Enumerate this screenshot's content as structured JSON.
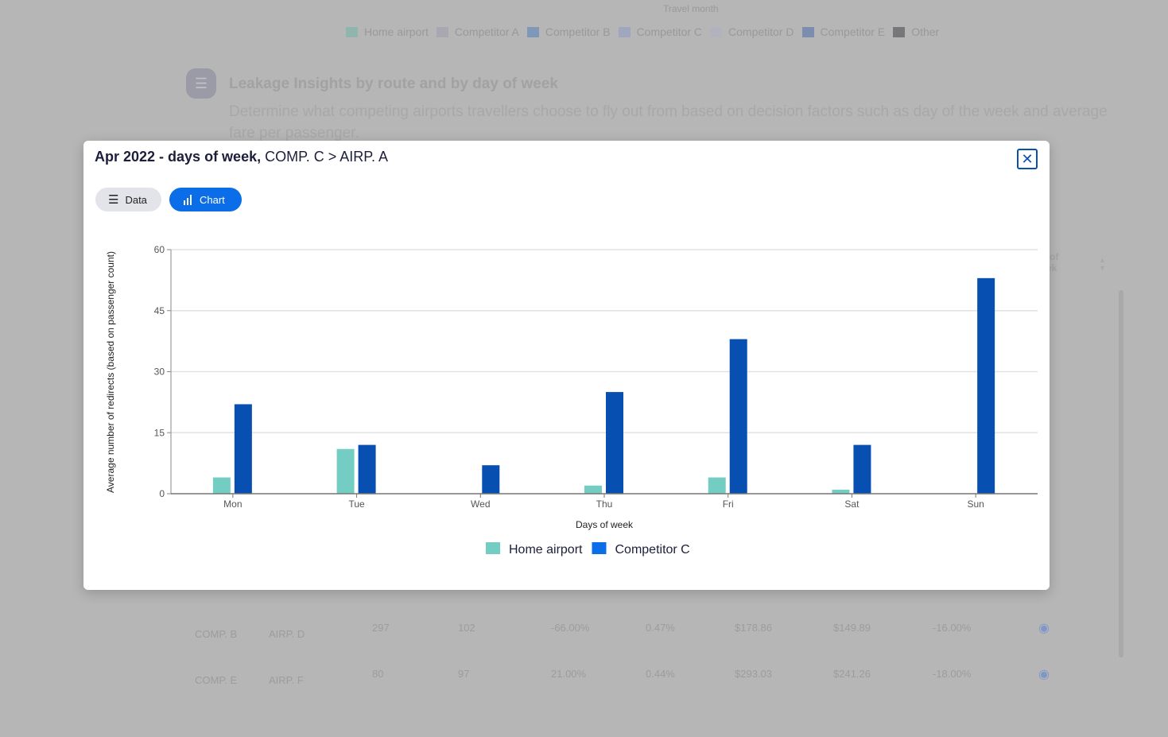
{
  "background": {
    "legend_title": "Travel month",
    "legend": [
      {
        "label": "Home airport",
        "color": "#8fb5ae"
      },
      {
        "label": "Competitor A",
        "color": "#a9a8b0"
      },
      {
        "label": "Competitor B",
        "color": "#7f97b8"
      },
      {
        "label": "Competitor C",
        "color": "#9ea7bd"
      },
      {
        "label": "Competitor D",
        "color": "#b1b2bd"
      },
      {
        "label": "Competitor E",
        "color": "#7d8db0"
      },
      {
        "label": "Other",
        "color": "#777679"
      }
    ],
    "section_title": "Leakage Insights by route and by day of week",
    "section_desc": "Determine what competing airports travellers choose to fly out from based on decision factors such as day of the week and average fare per passenger.",
    "column_header_partial": "...y of week",
    "rows": [
      [
        "COMP. B",
        "AIRP. D",
        "297",
        "102",
        "-66.00%",
        "0.47%",
        "$178.86",
        "$149.89",
        "-16.00%"
      ],
      [
        "COMP. E",
        "AIRP. F",
        "80",
        "97",
        "21.00%",
        "0.44%",
        "$293.03",
        "$241.26",
        "-18.00%"
      ]
    ]
  },
  "modal": {
    "title_bold": "Apr 2022 - days of week,",
    "title_rest": " COMP. C > AIRP. A",
    "tabs": [
      {
        "label": "Data",
        "icon": "list-icon",
        "active": false
      },
      {
        "label": "Chart",
        "icon": "bar-chart-icon",
        "active": true
      }
    ],
    "close_icon": "close-icon"
  },
  "chart_data": {
    "type": "bar",
    "xlabel": "Days of week",
    "ylabel": "Average number of redirects (based on passenger count)",
    "categories": [
      "Mon",
      "Tue",
      "Wed",
      "Thu",
      "Fri",
      "Sat",
      "Sun"
    ],
    "ylim": [
      0,
      60
    ],
    "yticks": [
      0,
      15,
      30,
      45,
      60
    ],
    "grid": true,
    "legend_placement": "bottom",
    "series": [
      {
        "name": "Home airport",
        "color": "#74cdc3",
        "values": [
          4,
          11,
          0,
          2,
          4,
          1,
          0
        ]
      },
      {
        "name": "Competitor C",
        "color": "#084fb2",
        "values": [
          22,
          12,
          7,
          25,
          38,
          12,
          53
        ]
      }
    ],
    "legend_swatch_colors": [
      "#74cdc3",
      "#0b6ee8"
    ]
  }
}
